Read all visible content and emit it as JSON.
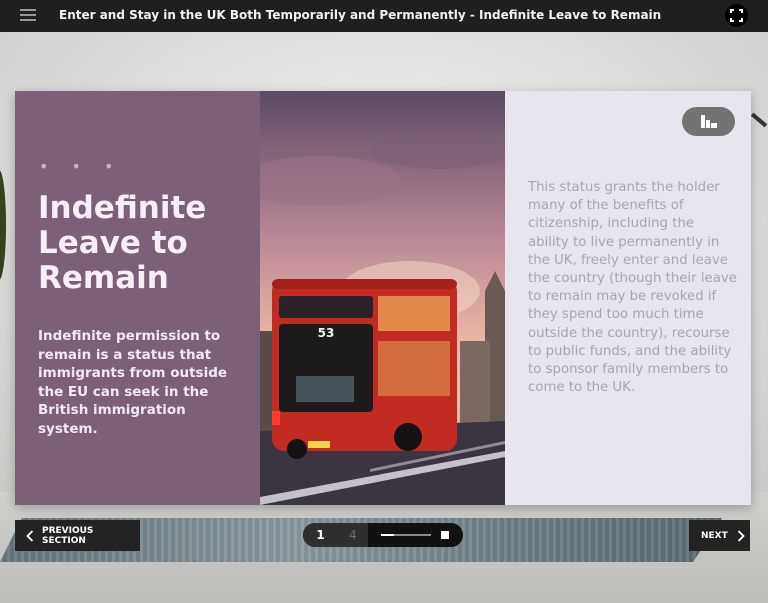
{
  "topbar": {
    "title": "Enter and Stay in the UK Both Temporarily and Permanently - Indefinite Leave to Remain",
    "menu_icon": "hamburger-menu-icon",
    "fullscreen_icon": "fullscreen-icon"
  },
  "slide": {
    "dots": "• • •",
    "heading": "Indefinite Leave to Remain",
    "subtext": "Indefinite permission to remain is a status that immigrants from outside the EU can seek in the British immigration system.",
    "photo": {
      "bus_number": "53"
    },
    "body": "This status grants the holder many of the benefits of citizenship, including the ability to live permanently in the UK, freely enter and leave the country (though their leave to remain may be revoked if they spend too much time outside the country), recourse to public funds, and the ability to sponsor family members to come to the UK.",
    "chart_button_icon": "bar-chart-icon"
  },
  "nav": {
    "prev_label": "PREVIOUS SECTION",
    "next_label": "NEXT",
    "current_page": "1",
    "total_pages": "4",
    "progress_fraction": 0.25
  },
  "colors": {
    "left_panel": "#7b6078",
    "right_panel": "#e8e5ef",
    "topbar": "#1f1f20",
    "nav_button": "#232323"
  }
}
